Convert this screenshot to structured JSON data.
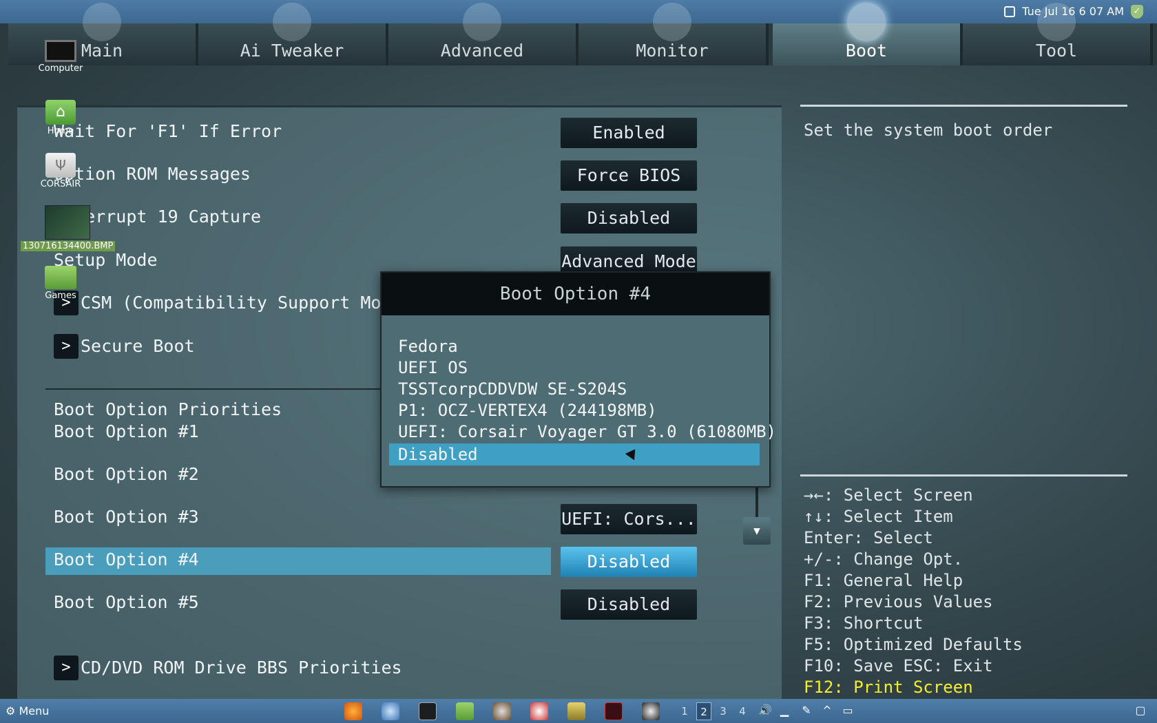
{
  "tabs": [
    {
      "label": "Main",
      "icon": "list-icon"
    },
    {
      "label": "Ai Tweaker",
      "icon": "tweaker-icon"
    },
    {
      "label": "Advanced",
      "icon": "advanced-icon"
    },
    {
      "label": "Monitor",
      "icon": "monitor-gauge-icon"
    },
    {
      "label": "Boot",
      "icon": "power-icon"
    },
    {
      "label": "Tool",
      "icon": "tool-icon"
    }
  ],
  "active_tab": "Boot",
  "clock": "Tue Jul 16  6 07 AM",
  "settings": [
    {
      "label": "Wait For 'F1' If Error",
      "value": "Enabled"
    },
    {
      "label": "Option ROM Messages",
      "value": "Force BIOS"
    },
    {
      "label": "Interrupt 19 Capture",
      "value": "Disabled"
    },
    {
      "label": "Setup Mode",
      "value": "Advanced Mode"
    }
  ],
  "submenus": {
    "csm": "CSM (Compatibility Support Module",
    "secure_boot": "Secure Boot",
    "cd_dvd": "CD/DVD ROM Drive BBS Priorities"
  },
  "boot_priorities": {
    "heading": "Boot Option Priorities",
    "options": [
      {
        "label": "Boot Option #1",
        "value": ""
      },
      {
        "label": "Boot Option #2",
        "value": ""
      },
      {
        "label": "Boot Option #3",
        "value": "UEFI: Cors..."
      },
      {
        "label": "Boot Option #4",
        "value": "Disabled"
      },
      {
        "label": "Boot Option #5",
        "value": "Disabled"
      }
    ]
  },
  "popup": {
    "title": "Boot Option #4",
    "options": [
      "Fedora",
      "UEFI OS",
      "TSSTcorpCDDVDW SE-S204S",
      "P1: OCZ-VERTEX4  (244198MB)",
      "UEFI: Corsair Voyager GT 3.0 (61080MB)",
      "Disabled"
    ],
    "selected": "Disabled"
  },
  "help": {
    "description": "Set the system boot order",
    "keys": [
      "→←: Select Screen",
      "↑↓: Select Item",
      "Enter: Select",
      "+/-: Change Opt.",
      "F1: General Help",
      "F2: Previous Values",
      "F3: Shortcut",
      "F5: Optimized Defaults",
      "F10: Save  ESC: Exit"
    ],
    "print_key": "F12: Print Screen"
  },
  "desktop_icons": [
    {
      "label": "Computer",
      "icon": "computer-icon"
    },
    {
      "label": "Home",
      "icon": "home-folder-icon"
    },
    {
      "label": "CORSAIR",
      "icon": "usb-drive-icon"
    },
    {
      "label": "130716134400.BMP",
      "icon": "image-file-icon"
    },
    {
      "label": "Games",
      "icon": "folder-icon"
    }
  ],
  "taskbar": {
    "menu_label": "Menu",
    "workspaces": [
      "1",
      "2",
      "3",
      "4"
    ],
    "active_workspace": "2",
    "apps": [
      "firefox-icon",
      "thunderbird-icon",
      "terminal-icon",
      "files-icon",
      "audio-player-icon",
      "image-viewer-icon",
      "tool-app-icon",
      "terminal-red-icon",
      "disk-utility-icon"
    ]
  },
  "colors": {
    "highlight": "#4a9ebc",
    "selected_button": "#2a9fd6",
    "hotkey": "#f5ee2a",
    "taskbar": "#4a78a3"
  }
}
